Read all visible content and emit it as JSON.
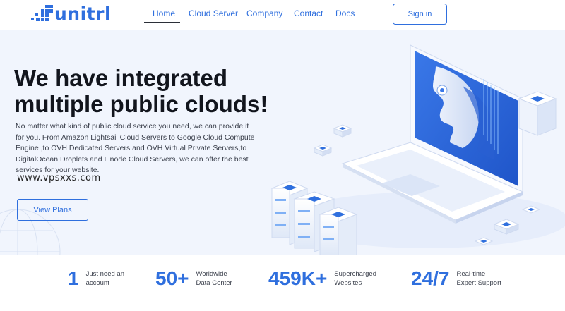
{
  "header": {
    "logo_text": "unitrl",
    "nav": [
      {
        "label": "Home",
        "active": true
      },
      {
        "label": "Cloud Server",
        "active": false
      },
      {
        "label": "Company",
        "active": false
      },
      {
        "label": "Contact",
        "active": false
      },
      {
        "label": "Docs",
        "active": false
      }
    ],
    "signin_label": "Sign in"
  },
  "hero": {
    "title_line1": "We have integrated",
    "title_line2": "multiple public clouds!",
    "description": "No matter what kind of public cloud service you need, we can provide it for you. From Amazon Lightsail Cloud Servers to Google Cloud Compute Engine ,to OVH Dedicated Servers and OVH Virtual Private Servers,to DigitalOcean Droplets and Linode Cloud Servers, we can offer the best services for your website.",
    "watermark": "www.vpsxxs.com",
    "cta_label": "View Plans"
  },
  "stats": [
    {
      "value": "1",
      "label": "Just need an account"
    },
    {
      "value": "50+",
      "label": "Worldwide Data Center"
    },
    {
      "value": "459K+",
      "label": "Supercharged Websites"
    },
    {
      "value": "24/7",
      "label": "Real-time Expert Support"
    }
  ],
  "colors": {
    "accent": "#2f6fde",
    "hero_bg": "#f1f5fd",
    "title": "#12151d"
  },
  "icons": {
    "logo": "pixel-grid-logo-icon",
    "hero_illustration": "laptop-ai-face-illustration",
    "background": "globe-icon"
  }
}
